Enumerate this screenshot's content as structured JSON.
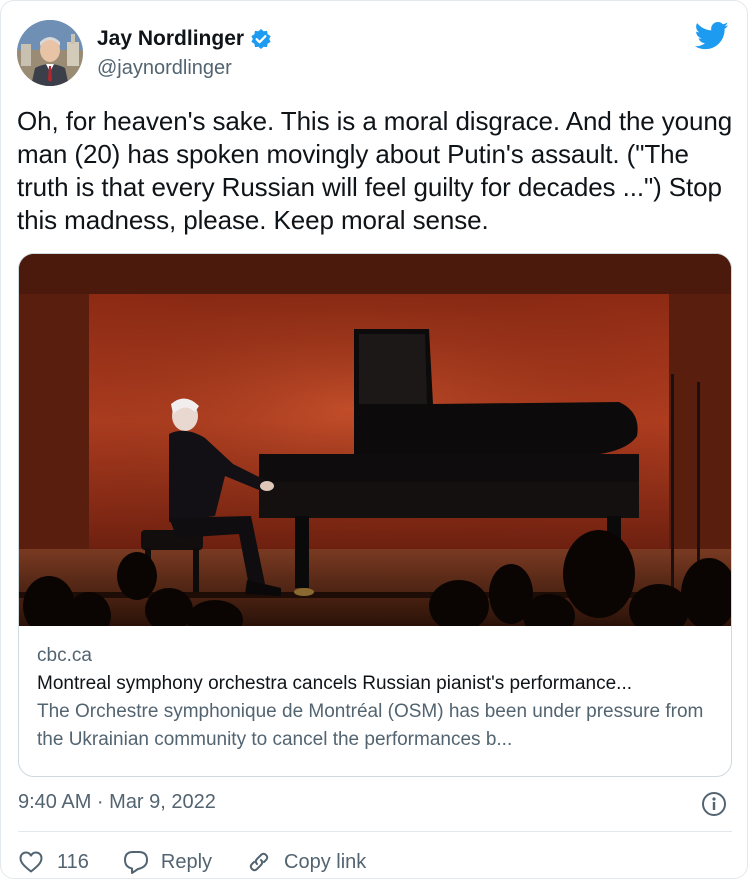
{
  "author": {
    "display_name": "Jay Nordlinger",
    "handle": "@jaynordlinger",
    "verified": true,
    "avatar_icon": "profile-photo"
  },
  "platform_icon": "twitter-bird-icon",
  "tweet": {
    "text": "Oh, for heaven's sake. This is a moral disgrace. And the young man (20) has spoken movingly about Putin's assault. (\"The truth is that every Russian will feel guilty for decades ...\") Stop this madness, please. Keep moral sense."
  },
  "link_card": {
    "domain": "cbc.ca",
    "title": "Montreal symphony orchestra cancels Russian pianist's performance...",
    "description": "The Orchestre symphonique de Montréal (OSM) has been under pressure from the Ukrainian community to cancel the performances b..."
  },
  "footer": {
    "timestamp": "9:40 AM · Mar 9, 2022",
    "likes": "116",
    "reply_label": "Reply",
    "copy_link_label": "Copy link"
  },
  "colors": {
    "brand_blue": "#1d9bf0",
    "muted_text": "#536471",
    "stage_red": "#a5361d"
  }
}
